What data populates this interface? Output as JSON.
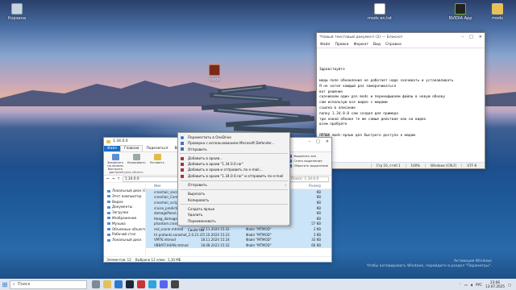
{
  "desktop": {
    "icons": [
      {
        "label": "Корзина",
        "name": "recycle-bin-icon"
      },
      {
        "label": "mods en.txt",
        "name": "text-file-icon"
      },
      {
        "label": "NVIDIA App",
        "name": "nvidia-app-icon"
      },
      {
        "label": "mods",
        "name": "mods-folder-icon"
      },
      {
        "label": "mods",
        "name": "mods-shortcut-icon"
      }
    ]
  },
  "notepad": {
    "title": "*Новый текстовый документ (2) — Блокнот",
    "menu": [
      "Файл",
      "Правка",
      "Формат",
      "Вид",
      "Справка"
    ],
    "lines": [
      "",
      "",
      "",
      "Здравствуйте",
      "",
      "моды поле обновления не работает надо скачивать и устанавливать",
      "Я не хотел каждый раз заморачиваться",
      "вот решение",
      "скачиваем один раз mods и перекидываем файлы в новую обнову",
      "сам использую все видео с модами",
      "ссылка в описание",
      "папку 1.34.0.0 сам создал для примера",
      "три новой обнове те же самые действия как на видео",
      "всем пробуйте",
      "",
      "ЯРЛЫК mods-ярлык для быстрого доступа к модам"
    ],
    "status": {
      "pos": "Стр 16, стлб 1",
      "zoom": "100%",
      "eol": "Windows (CRLF)",
      "enc": "UTF-8"
    }
  },
  "explorer": {
    "title": "1.34.0.0",
    "tabs": [
      "Файл",
      "Главная",
      "Поделиться",
      "Вид"
    ],
    "ribbon": {
      "buttons": [
        "Закрепить на панели быстрого доступа",
        "Копировать",
        "Вставить"
      ],
      "group_label": "Буфер обмена",
      "right": [
        "Выделить все",
        "Снять выделение",
        "Обратить выделение"
      ]
    },
    "address": "1.34.0.0",
    "search_placeholder": "Поиск: 1.34.0.0",
    "nav": [
      "Этот компьютер",
      "Видео",
      "Документы",
      "Загрузки",
      "Изображения",
      "Музыка",
      "Объемные объекты",
      "Рабочий стол",
      "Локальный диск"
    ],
    "nav_top": "Локальный диск (C:)",
    "columns": {
      "name": "Имя",
      "size": "Размер"
    },
    "rows": [
      {
        "name": "crosshair_ancad",
        "date": "",
        "type": "",
        "size": "KB",
        "sel": true
      },
      {
        "name": "crosshair_Comm",
        "date": "",
        "type": "",
        "size": "KB",
        "sel": true
      },
      {
        "name": "crosshair_script",
        "date": "",
        "type": "",
        "size": "KB",
        "sel": true
      },
      {
        "name": "cruise_predictio",
        "date": "",
        "type": "",
        "size": "KB",
        "sel": true
      },
      {
        "name": "damagePanel.mt",
        "date": "",
        "type": "",
        "size": "KB",
        "sel": true
      },
      {
        "name": "Haeg_damage.m",
        "date": "",
        "type": "",
        "size": "KB",
        "sel": true
      },
      {
        "name": "phantom.crosshair_script.mtmod",
        "date": "18.11.2024 15:29",
        "type": "Файл \"MTMOD\"",
        "size": "57 KB",
        "sel": true
      },
      {
        "name": "red_scorer.mtmod",
        "date": "17.11.2024 15:32",
        "type": "Файл \"MTMOD\"",
        "size": "2 KB",
        "sel": true
      },
      {
        "name": "tri.protanki.sarashot_2.0.21.mtmod",
        "date": "25.10.2024 15:23",
        "type": "Файл \"MTMOD\"",
        "size": "3 KB",
        "sel": true
      },
      {
        "name": "VMTK.mtmod",
        "date": "18.11.2024 15:24",
        "type": "Файл \"MTMOD\"",
        "size": "33 KB",
        "sel": true
      },
      {
        "name": "VBBATCH4AN.mtmod",
        "date": "18.08.2023 15:32",
        "type": "Файл \"MTMOD\"",
        "size": "66 KB",
        "sel": true
      }
    ],
    "status": {
      "count": "Элементов: 12",
      "selected": "Выбрано 12 элем.: 1,10 МБ"
    }
  },
  "context_menu": {
    "items": [
      {
        "label": "Переместить в OneDrive",
        "icon": "onedrive-icon",
        "kind": "od"
      },
      {
        "label": "Проверка с использованием Microsoft Defender...",
        "icon": "defender-icon",
        "kind": "df"
      },
      {
        "label": "Отправить",
        "icon": "share-icon",
        "kind": "df"
      },
      {
        "sep": true
      },
      {
        "label": "Добавить в архив...",
        "icon": "archive-icon",
        "kind": "ic"
      },
      {
        "label": "Добавить в архив \"1.34.0.0.rar\"",
        "icon": "archive-icon",
        "kind": "ic"
      },
      {
        "label": "Добавить в архив и отправить по e-mail...",
        "icon": "archive-icon",
        "kind": "ic"
      },
      {
        "label": "Добавить в архив \"1.34.0.0.rar\" и отправить по e-mail",
        "icon": "archive-icon",
        "kind": "ic"
      },
      {
        "sep": true
      },
      {
        "label": "Отправить",
        "icon": "",
        "kind": "",
        "arrow": "›"
      },
      {
        "sep": true
      },
      {
        "label": "Вырезать",
        "icon": "",
        "kind": ""
      },
      {
        "label": "Копировать",
        "icon": "",
        "kind": ""
      },
      {
        "sep": true
      },
      {
        "label": "Создать ярлык",
        "icon": "",
        "kind": ""
      },
      {
        "label": "Удалить",
        "icon": "",
        "kind": ""
      },
      {
        "label": "Переименовать",
        "icon": "",
        "kind": ""
      },
      {
        "sep": true
      },
      {
        "label": "Свойства",
        "icon": "",
        "kind": ""
      }
    ]
  },
  "taskbar": {
    "search_placeholder": "Поиск",
    "lang": "РУС",
    "time": "23:06",
    "date": "13.07.2025"
  },
  "watermark": {
    "line1": "Активация Windows",
    "line2": "Чтобы активировать Windows, перейдите в раздел \"Параметры\"."
  },
  "colors": {
    "accent": "#1a6fc9",
    "selection": "#cce4f7"
  }
}
